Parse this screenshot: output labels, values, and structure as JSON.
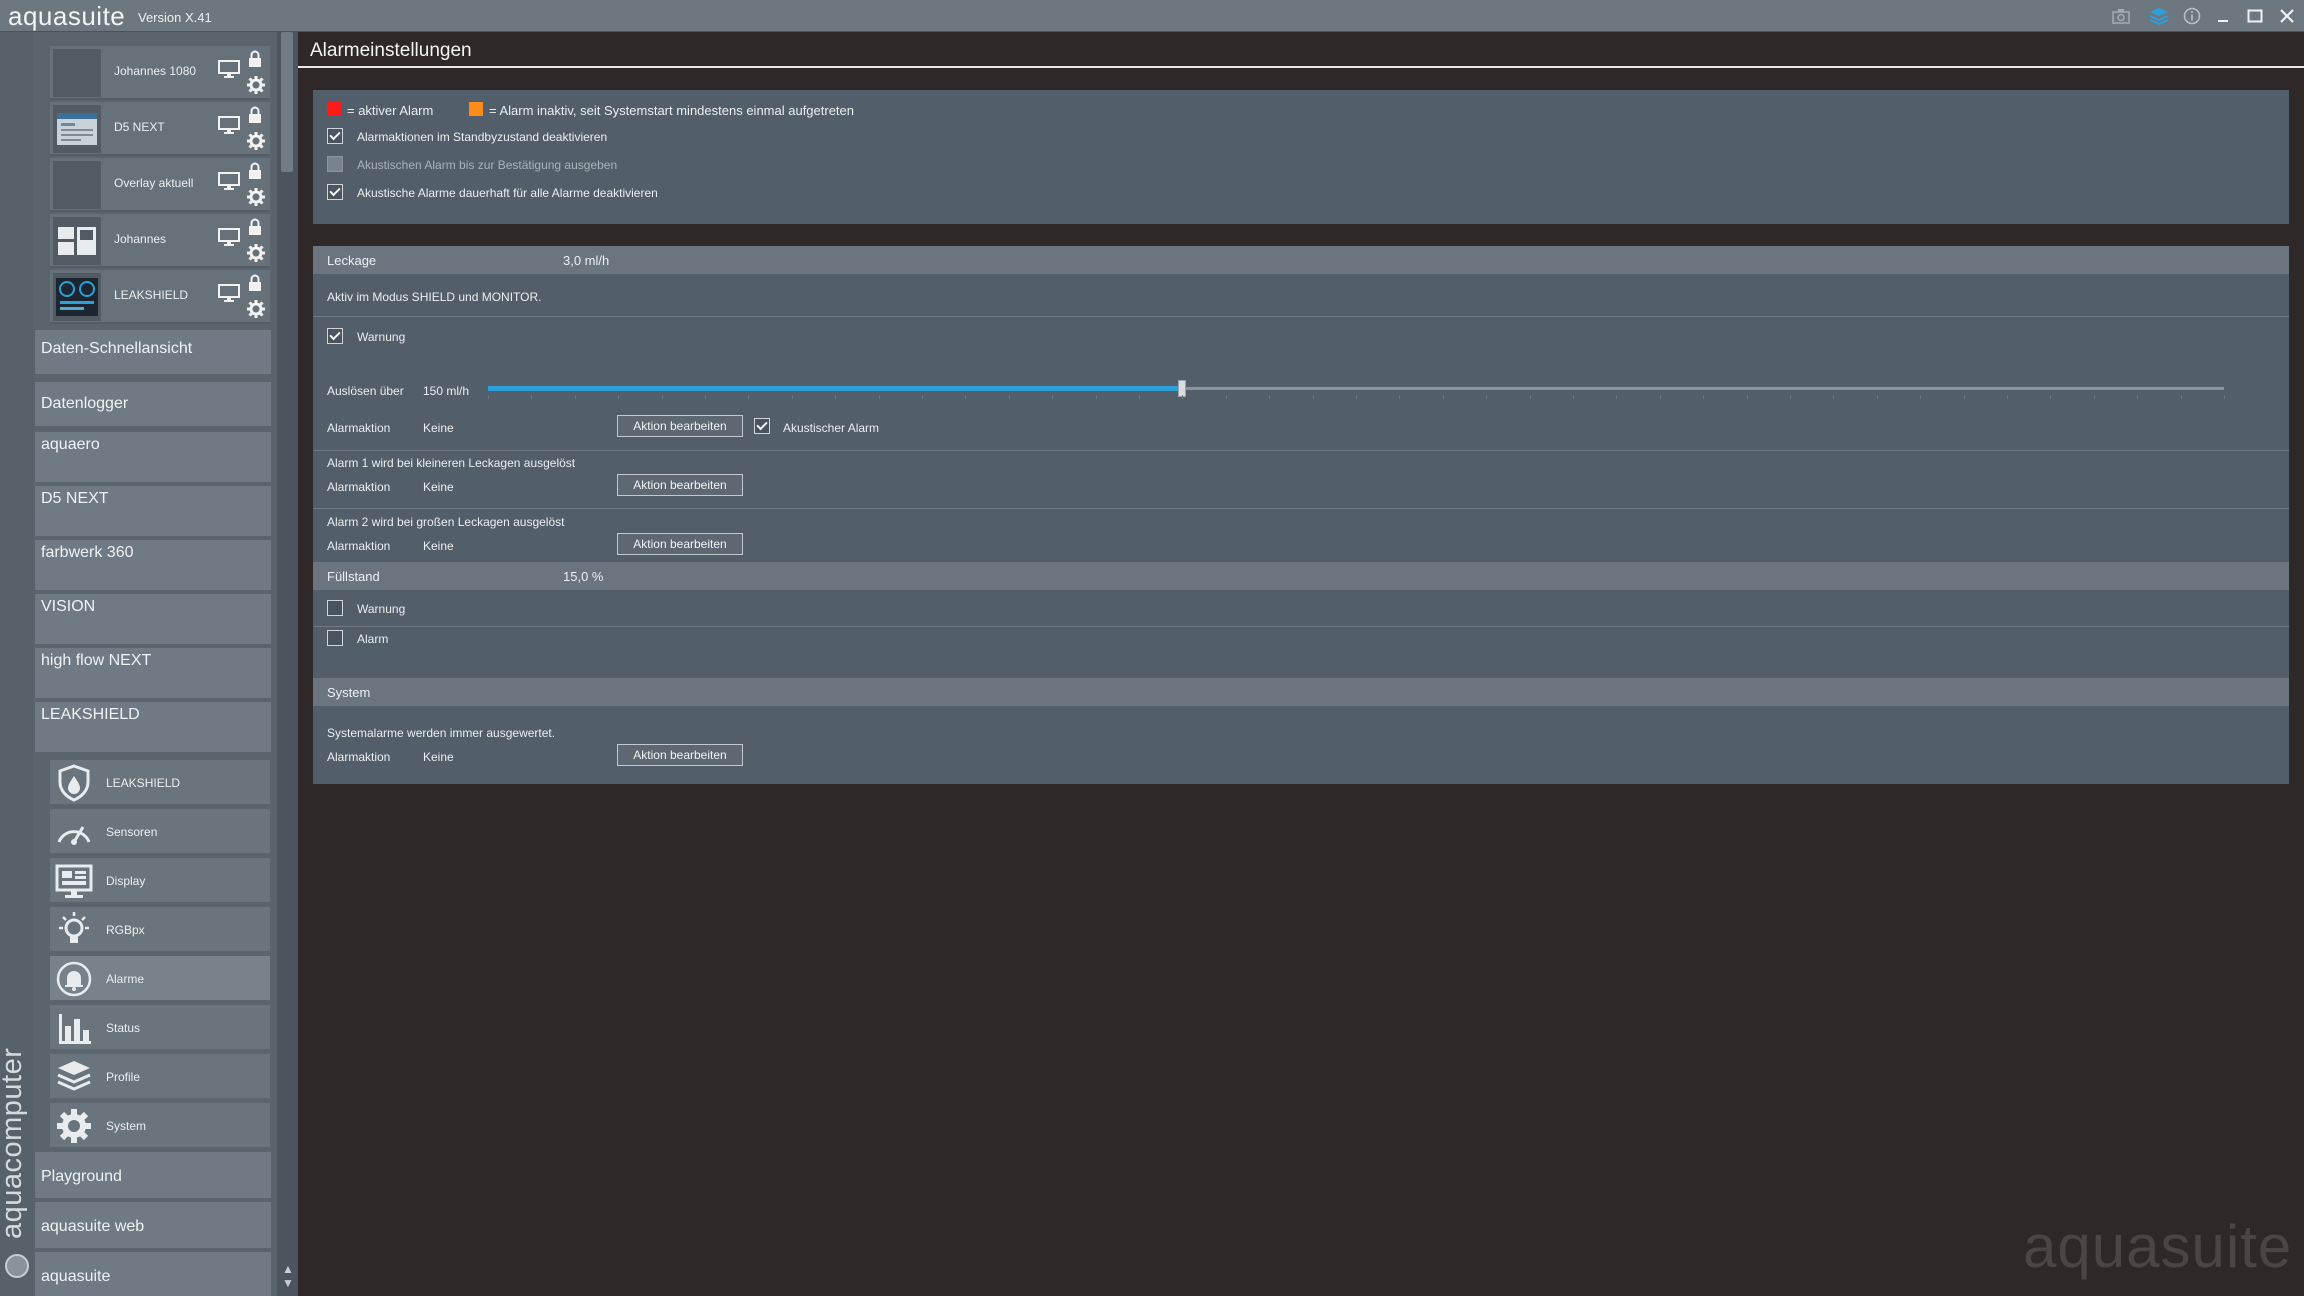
{
  "app": {
    "title": "aquasuite",
    "version": "Version X.41",
    "watermark": "aquasuite",
    "brand_vertical": "aquacomputer"
  },
  "titlebar": {
    "icons": [
      "camera-icon",
      "layers-icon",
      "info-icon",
      "minimize-icon",
      "maximize-icon",
      "close-icon"
    ]
  },
  "sidebar": {
    "dashboards": [
      {
        "label": "Johannes 1080",
        "thumb": "blank"
      },
      {
        "label": "D5 NEXT",
        "thumb": "device"
      },
      {
        "label": "Overlay aktuell",
        "thumb": "blank"
      },
      {
        "label": "Johannes",
        "thumb": "grid"
      },
      {
        "label": "LEAKSHIELD",
        "thumb": "gauges"
      }
    ],
    "nav_top": [
      {
        "label": "Daten-Schnellansicht"
      },
      {
        "label": "Datenlogger"
      },
      {
        "label": "aquaero"
      },
      {
        "label": "D5 NEXT"
      },
      {
        "label": "farbwerk 360"
      },
      {
        "label": "VISION"
      },
      {
        "label": "high flow NEXT"
      },
      {
        "label": "LEAKSHIELD"
      }
    ],
    "sub_items": [
      {
        "label": "LEAKSHIELD",
        "icon": "shield-icon"
      },
      {
        "label": "Sensoren",
        "icon": "gauge-icon"
      },
      {
        "label": "Display",
        "icon": "display-icon"
      },
      {
        "label": "RGBpx",
        "icon": "bulb-icon"
      },
      {
        "label": "Alarme",
        "icon": "bell-icon"
      },
      {
        "label": "Status",
        "icon": "bar-chart-icon"
      },
      {
        "label": "Profile",
        "icon": "layers-icon"
      },
      {
        "label": "System",
        "icon": "gear-icon"
      }
    ],
    "nav_bottom": [
      {
        "label": "Playground"
      },
      {
        "label": "aquasuite web"
      },
      {
        "label": "aquasuite"
      }
    ]
  },
  "page": {
    "title": "Alarmeinstellungen"
  },
  "general": {
    "legend_active": "= aktiver Alarm",
    "legend_inactive": "= Alarm inaktiv, seit Systemstart mindestens einmal aufgetreten",
    "color_active": "#ff1a1a",
    "color_inactive": "#ff8c1a",
    "options": [
      {
        "label": "Alarmaktionen im Standbyzustand deaktivieren",
        "checked": true,
        "enabled": true
      },
      {
        "label": "Akustischen Alarm bis zur Bestätigung ausgeben",
        "checked": false,
        "enabled": false
      },
      {
        "label": "Akustische Alarme dauerhaft für alle Alarme deaktivieren",
        "checked": true,
        "enabled": true
      }
    ]
  },
  "leak": {
    "header_label": "Leckage",
    "header_value": "3,0 ml/h",
    "mode_text": "Aktiv im Modus SHIELD und MONITOR.",
    "warning_label": "Warnung",
    "warning_checked": true,
    "trigger_label": "Auslösen über",
    "trigger_value": "150 ml/h",
    "slider_fraction": 0.4,
    "action_label": "Alarmaktion",
    "action_value": "Keine",
    "edit_button": "Aktion bearbeiten",
    "acoustic_label": "Akustischer Alarm",
    "acoustic_checked": true,
    "alarm1_text": "Alarm 1 wird bei kleineren Leckagen ausgelöst",
    "alarm2_text": "Alarm 2 wird bei großen Leckagen ausgelöst"
  },
  "fill": {
    "header_label": "Füllstand",
    "header_value": "15,0 %",
    "warning_label": "Warnung",
    "alarm_label": "Alarm"
  },
  "system": {
    "header_label": "System",
    "info_text": "Systemalarme werden immer ausgewertet.",
    "action_label": "Alarmaktion",
    "action_value": "Keine",
    "edit_button": "Aktion bearbeiten"
  }
}
